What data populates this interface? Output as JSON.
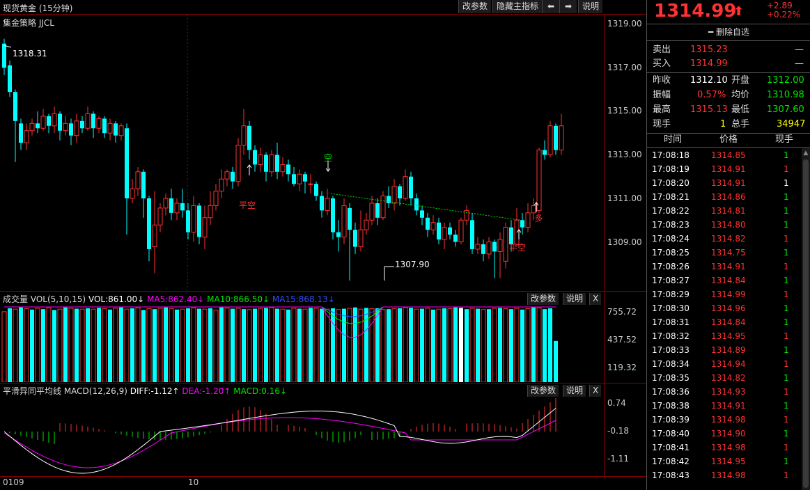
{
  "chart_header": {
    "title": "现货黄金 (15分钟)",
    "strategy": "集金策略 JJCL",
    "btn_params": "改参数",
    "btn_hide": "隐藏主指标",
    "btn_left": "⬅",
    "btn_right": "➡",
    "btn_help": "说明"
  },
  "price_axis": [
    "1319.00",
    "1317.00",
    "1315.00",
    "1313.00",
    "1311.00",
    "1309.00"
  ],
  "annotations": {
    "high": "1318.31",
    "low": "1307.90",
    "kong": "空",
    "pingkong1": "平空",
    "pingkong2": "平空",
    "duo": "多"
  },
  "volume_panel": {
    "label": "成交量 VOL(5,10,15)",
    "vol": "VOL:861.00↓",
    "ma5": "MA5:862.40↓",
    "ma10": "MA10:866.50↓",
    "ma15": "MA15:868.13↓",
    "axis": [
      "755.72",
      "437.52",
      "119.32"
    ],
    "btn_params": "改参数",
    "btn_help": "说明",
    "btn_close": "X"
  },
  "macd_panel": {
    "label": "平滑异同平均线 MACD(12,26,9)",
    "diff": "DIFF:-1.12↑",
    "dea": "DEA:-1.20↑",
    "macd": "MACD:0.16↓",
    "axis": [
      "0.74",
      "-0.18",
      "-1.11"
    ],
    "btn_params": "改参数",
    "btn_help": "说明",
    "btn_close": "X"
  },
  "time_axis": [
    "0109",
    "10"
  ],
  "quote": {
    "price": "1314.99",
    "change": "+2.89",
    "change_pct": "+0.22%",
    "remove_fav": "━ 删除自选",
    "sell_label": "卖出",
    "sell_price": "1315.23",
    "sell_vol": "—",
    "buy_label": "买入",
    "buy_price": "1314.99",
    "buy_vol": "—",
    "prev_close_label": "昨收",
    "prev_close": "1312.10",
    "open_label": "开盘",
    "open": "1312.00",
    "amplitude_label": "振幅",
    "amplitude": "0.57%",
    "avg_label": "均价",
    "avg": "1310.98",
    "high_label": "最高",
    "high": "1315.13",
    "low_label": "最低",
    "low": "1307.60",
    "cur_vol_label": "现手",
    "cur_vol": "1",
    "total_vol_label": "总手",
    "total_vol": "34947"
  },
  "ticks_header": {
    "time": "时间",
    "price": "价格",
    "vol": "现手"
  },
  "ticks": [
    {
      "t": "17:08:18",
      "p": "1314.85",
      "v": "1",
      "c": "green"
    },
    {
      "t": "17:08:19",
      "p": "1314.91",
      "v": "1",
      "c": "red"
    },
    {
      "t": "17:08:20",
      "p": "1314.91",
      "v": "1",
      "c": "white"
    },
    {
      "t": "17:08:21",
      "p": "1314.86",
      "v": "1",
      "c": "green"
    },
    {
      "t": "17:08:22",
      "p": "1314.81",
      "v": "1",
      "c": "green"
    },
    {
      "t": "17:08:23",
      "p": "1314.80",
      "v": "1",
      "c": "green"
    },
    {
      "t": "17:08:24",
      "p": "1314.82",
      "v": "1",
      "c": "red"
    },
    {
      "t": "17:08:25",
      "p": "1314.75",
      "v": "1",
      "c": "green"
    },
    {
      "t": "17:08:26",
      "p": "1314.91",
      "v": "1",
      "c": "red"
    },
    {
      "t": "17:08:27",
      "p": "1314.84",
      "v": "1",
      "c": "green"
    },
    {
      "t": "17:08:29",
      "p": "1314.99",
      "v": "1",
      "c": "red"
    },
    {
      "t": "17:08:30",
      "p": "1314.96",
      "v": "1",
      "c": "green"
    },
    {
      "t": "17:08:31",
      "p": "1314.84",
      "v": "1",
      "c": "green"
    },
    {
      "t": "17:08:32",
      "p": "1314.95",
      "v": "1",
      "c": "red"
    },
    {
      "t": "17:08:33",
      "p": "1314.89",
      "v": "1",
      "c": "green"
    },
    {
      "t": "17:08:34",
      "p": "1314.94",
      "v": "1",
      "c": "red"
    },
    {
      "t": "17:08:35",
      "p": "1314.82",
      "v": "1",
      "c": "green"
    },
    {
      "t": "17:08:36",
      "p": "1314.93",
      "v": "1",
      "c": "red"
    },
    {
      "t": "17:08:38",
      "p": "1314.91",
      "v": "1",
      "c": "green"
    },
    {
      "t": "17:08:39",
      "p": "1314.98",
      "v": "1",
      "c": "red"
    },
    {
      "t": "17:08:40",
      "p": "1314.90",
      "v": "1",
      "c": "green"
    },
    {
      "t": "17:08:41",
      "p": "1314.98",
      "v": "1",
      "c": "red"
    },
    {
      "t": "17:08:42",
      "p": "1314.95",
      "v": "1",
      "c": "green"
    },
    {
      "t": "17:08:43",
      "p": "1314.98",
      "v": "1",
      "c": "red"
    }
  ],
  "chart_data": {
    "type": "candlestick",
    "y_range": [
      1308.0,
      1319.4
    ],
    "candles": [
      [
        1318.2,
        1317.2,
        1318.4,
        1316.9
      ],
      [
        1317.3,
        1316.2,
        1317.5,
        1316.0
      ],
      [
        1316.2,
        1315.0,
        1316.3,
        1313.3
      ],
      [
        1314.9,
        1314.1,
        1315.1,
        1313.8
      ],
      [
        1314.1,
        1314.6,
        1314.9,
        1313.8
      ],
      [
        1314.6,
        1314.9,
        1315.1,
        1314.4
      ],
      [
        1314.9,
        1314.7,
        1315.4,
        1314.5
      ],
      [
        1314.7,
        1315.2,
        1315.5,
        1314.6
      ],
      [
        1315.2,
        1314.8,
        1315.3,
        1314.5
      ],
      [
        1314.8,
        1315.3,
        1315.6,
        1314.5
      ],
      [
        1315.3,
        1314.6,
        1315.4,
        1314.2
      ],
      [
        1314.6,
        1314.9,
        1315.2,
        1314.4
      ],
      [
        1314.9,
        1314.4,
        1315.1,
        1314.0
      ],
      [
        1314.4,
        1315.0,
        1315.3,
        1314.1
      ],
      [
        1315.0,
        1314.7,
        1315.2,
        1314.5
      ],
      [
        1314.7,
        1315.3,
        1315.6,
        1314.6
      ],
      [
        1315.3,
        1314.7,
        1315.4,
        1314.3
      ],
      [
        1314.7,
        1315.1,
        1315.2,
        1314.5
      ],
      [
        1315.1,
        1314.5,
        1315.2,
        1314.3
      ],
      [
        1314.5,
        1314.9,
        1315.1,
        1314.2
      ],
      [
        1314.9,
        1314.4,
        1315.0,
        1314.1
      ],
      [
        1314.4,
        1314.8,
        1314.9,
        1314.2
      ],
      [
        1314.7,
        1311.8,
        1314.9,
        1310.3
      ],
      [
        1311.8,
        1312.2,
        1312.6,
        1311.6
      ],
      [
        1312.2,
        1312.9,
        1313.1,
        1311.9
      ],
      [
        1312.9,
        1311.8,
        1313.0,
        1311.0
      ],
      [
        1311.8,
        1309.7,
        1311.9,
        1309.2
      ],
      [
        1309.8,
        1310.7,
        1312.1,
        1308.7
      ],
      [
        1310.7,
        1311.4,
        1311.6,
        1310.4
      ],
      [
        1311.4,
        1311.8,
        1312.0,
        1311.1
      ],
      [
        1311.8,
        1311.2,
        1312.2,
        1310.9
      ],
      [
        1311.2,
        1311.6,
        1311.8,
        1310.9
      ],
      [
        1311.6,
        1311.3,
        1312.2,
        1311.0
      ],
      [
        1311.3,
        1310.4,
        1311.6,
        1310.1
      ],
      [
        1310.4,
        1311.5,
        1311.9,
        1310.0
      ],
      [
        1311.5,
        1310.2,
        1311.6,
        1309.9
      ],
      [
        1310.2,
        1311.0,
        1311.5,
        1309.7
      ],
      [
        1311.0,
        1311.5,
        1312.1,
        1310.7
      ],
      [
        1311.5,
        1312.1,
        1312.4,
        1311.3
      ],
      [
        1312.1,
        1312.6,
        1313.0,
        1311.8
      ],
      [
        1312.6,
        1312.9,
        1313.0,
        1312.3
      ],
      [
        1312.9,
        1312.5,
        1313.1,
        1312.2
      ],
      [
        1312.5,
        1314.0,
        1314.3,
        1312.3
      ],
      [
        1314.0,
        1314.8,
        1315.5,
        1313.6
      ],
      [
        1314.8,
        1313.8,
        1315.0,
        1313.4
      ],
      [
        1313.8,
        1313.2,
        1314.0,
        1312.9
      ],
      [
        1313.2,
        1313.6,
        1313.9,
        1312.9
      ],
      [
        1313.6,
        1312.9,
        1313.7,
        1312.5
      ],
      [
        1312.9,
        1313.6,
        1313.8,
        1312.7
      ],
      [
        1313.6,
        1312.9,
        1314.1,
        1312.6
      ],
      [
        1312.9,
        1313.2,
        1313.5,
        1312.7
      ],
      [
        1313.2,
        1312.8,
        1313.4,
        1312.5
      ],
      [
        1312.8,
        1312.4,
        1313.1,
        1312.3
      ],
      [
        1312.4,
        1312.8,
        1313.0,
        1312.1
      ],
      [
        1312.8,
        1312.5,
        1312.9,
        1312.0
      ],
      [
        1312.4,
        1312.4,
        1312.8,
        1312.0
      ],
      [
        1312.4,
        1311.9,
        1312.5,
        1311.7
      ],
      [
        1311.9,
        1311.3,
        1312.1,
        1311.0
      ],
      [
        1311.3,
        1311.8,
        1312.2,
        1311.1
      ],
      [
        1311.8,
        1310.4,
        1311.9,
        1310.1
      ],
      [
        1310.4,
        1310.2,
        1310.9,
        1309.6
      ],
      [
        1310.2,
        1311.5,
        1311.8,
        1309.9
      ],
      [
        1311.4,
        1310.5,
        1311.6,
        1308.4
      ],
      [
        1310.5,
        1309.8,
        1310.8,
        1309.5
      ],
      [
        1309.8,
        1310.5,
        1311.3,
        1309.6
      ],
      [
        1310.5,
        1310.9,
        1311.2,
        1310.3
      ],
      [
        1310.9,
        1311.6,
        1311.9,
        1310.7
      ],
      [
        1311.6,
        1311.0,
        1311.8,
        1310.7
      ],
      [
        1311.0,
        1311.9,
        1312.1,
        1310.9
      ],
      [
        1311.9,
        1311.6,
        1312.3,
        1311.4
      ],
      [
        1311.6,
        1312.3,
        1312.6,
        1311.3
      ],
      [
        1312.3,
        1311.8,
        1312.4,
        1311.5
      ],
      [
        1311.8,
        1312.7,
        1313.0,
        1311.7
      ],
      [
        1312.7,
        1311.8,
        1312.9,
        1311.5
      ],
      [
        1311.8,
        1311.3,
        1312.0,
        1311.1
      ],
      [
        1311.3,
        1311.0,
        1311.5,
        1310.7
      ],
      [
        1311.0,
        1310.5,
        1311.2,
        1310.2
      ],
      [
        1310.5,
        1310.8,
        1311.1,
        1310.3
      ],
      [
        1310.8,
        1310.1,
        1311.0,
        1309.9
      ],
      [
        1310.1,
        1310.6,
        1310.8,
        1309.7
      ],
      [
        1310.6,
        1310.3,
        1310.8,
        1310.1
      ],
      [
        1310.3,
        1310.0,
        1310.5,
        1309.8
      ],
      [
        1310.0,
        1310.9,
        1311.0,
        1309.9
      ],
      [
        1310.9,
        1311.3,
        1311.5,
        1310.7
      ],
      [
        1310.9,
        1309.7,
        1311.2,
        1309.5
      ],
      [
        1309.7,
        1309.9,
        1310.2,
        1309.5
      ],
      [
        1309.9,
        1309.5,
        1310.1,
        1309.2
      ],
      [
        1309.5,
        1310.0,
        1310.2,
        1309.3
      ],
      [
        1310.0,
        1309.6,
        1310.1,
        1308.5
      ],
      [
        1309.6,
        1310.1,
        1310.4,
        1308.5
      ],
      [
        1309.2,
        1310.6,
        1310.8,
        1308.9
      ],
      [
        1310.6,
        1309.9,
        1310.9,
        1309.6
      ],
      [
        1309.9,
        1310.9,
        1311.4,
        1309.8
      ],
      [
        1310.9,
        1310.6,
        1311.2,
        1310.3
      ],
      [
        1310.6,
        1311.2,
        1311.6,
        1310.4
      ],
      [
        1311.2,
        1311.5,
        1311.8,
        1310.9
      ],
      [
        1311.3,
        1313.8,
        1313.9,
        1311.2
      ],
      [
        1313.8,
        1313.6,
        1314.2,
        1313.4
      ],
      [
        1313.6,
        1314.8,
        1315.0,
        1313.5
      ],
      [
        1314.8,
        1313.8,
        1314.9,
        1313.6
      ],
      [
        1313.8,
        1314.8,
        1315.3,
        1313.6
      ]
    ],
    "volumes": [
      "r",
      "c",
      "r",
      "c",
      "r",
      "c",
      "r",
      "c",
      "r",
      "c",
      "r",
      "c",
      "r",
      "c",
      "r",
      "c",
      "r",
      "c",
      "r",
      "c",
      "r",
      "c",
      "r",
      "c",
      "r",
      "c",
      "r",
      "c",
      "r",
      "c",
      "r",
      "c",
      "r",
      "c",
      "r",
      "c",
      "r",
      "c",
      "r",
      "c",
      "r",
      "c",
      "r",
      "c",
      "r",
      "c",
      "r",
      "c",
      "r",
      "c",
      "r",
      "c",
      "r",
      "c",
      "r",
      "c",
      "r",
      "c",
      "r",
      "c",
      "r",
      "c",
      "r",
      "c",
      "r",
      "c",
      "r",
      "c",
      "r",
      "c",
      "r",
      "c",
      "r",
      "c",
      "r",
      "c",
      "r",
      "c",
      "r",
      "c",
      "r",
      "c",
      "w",
      "c",
      "r",
      "c",
      "r",
      "c",
      "r",
      "c",
      "r",
      "c",
      "r",
      "c",
      "r",
      "c",
      "r"
    ],
    "volume_values": [
      820,
      860,
      850,
      870,
      855,
      845,
      860,
      850,
      865,
      840,
      850,
      870,
      860,
      855,
      850,
      860,
      850,
      865,
      855,
      845,
      860,
      870,
      850,
      860,
      865,
      840,
      855,
      850,
      860,
      870,
      855,
      845,
      850,
      860,
      865,
      855,
      850,
      860,
      840,
      870,
      865,
      855,
      860,
      850,
      845,
      855,
      860,
      865,
      870,
      855,
      850,
      845,
      860,
      855,
      850,
      865,
      860,
      855,
      850,
      860,
      845,
      855,
      860,
      870,
      850,
      865,
      855,
      860,
      845,
      850,
      855,
      860,
      870,
      865,
      850,
      855,
      860,
      845,
      850,
      860,
      855,
      870,
      865,
      850,
      860,
      855,
      845,
      850,
      860,
      865,
      855,
      850,
      860,
      845,
      855,
      870,
      865,
      850,
      860,
      480
    ],
    "trend_line": {
      "from_price": 1312.0,
      "to_price": 1310.9
    }
  }
}
